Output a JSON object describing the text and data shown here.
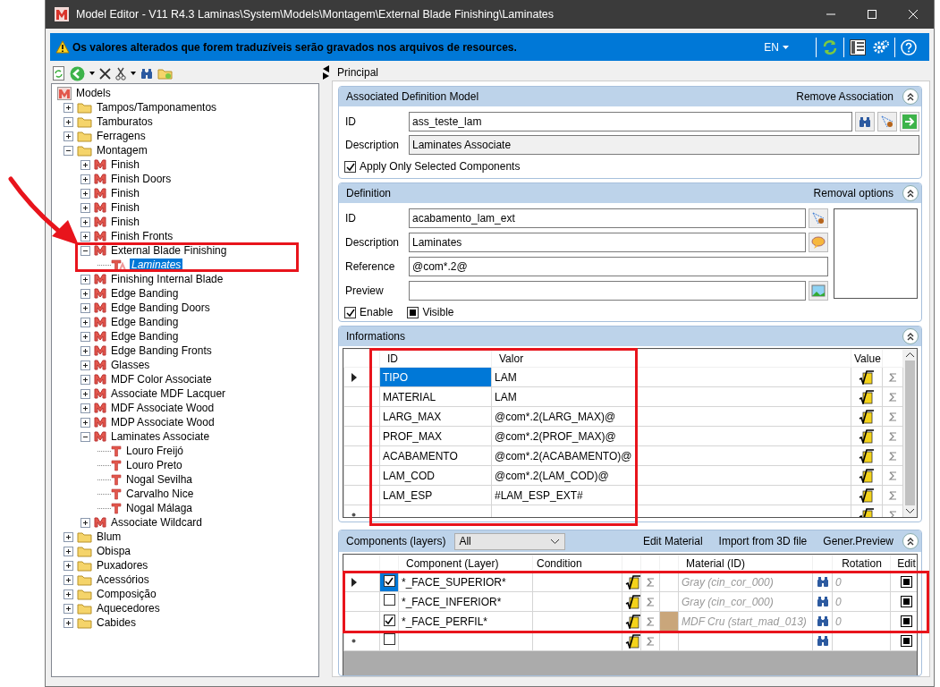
{
  "window": {
    "title": "Model Editor - V11 R4.3 Laminas\\System\\Models\\Montagem\\External Blade Finishing\\Laminates"
  },
  "info_bar": {
    "message": "Os valores alterados que forem traduzíveis serão gravados nos arquivos de resources.",
    "language": "EN"
  },
  "tree": [
    {
      "label": "Models",
      "kind": "root",
      "selected": false,
      "children": [
        {
          "label": "Tampos/Tamponamentos",
          "kind": "folder",
          "expanded": false,
          "selected": false
        },
        {
          "label": "Tamburatos",
          "kind": "folder",
          "expanded": false,
          "selected": false
        },
        {
          "label": "Ferragens",
          "kind": "folder",
          "expanded": false,
          "selected": false
        },
        {
          "label": "Montagem",
          "kind": "folder",
          "expanded": true,
          "selected": false,
          "children": [
            {
              "label": "Finish",
              "kind": "model",
              "expanded": false,
              "selected": false
            },
            {
              "label": "Finish Doors",
              "kind": "model",
              "expanded": false,
              "selected": false
            },
            {
              "label": "Finish",
              "kind": "model",
              "expanded": false,
              "selected": false
            },
            {
              "label": "Finish",
              "kind": "model",
              "expanded": false,
              "selected": false
            },
            {
              "label": "Finish",
              "kind": "model",
              "expanded": false,
              "selected": false
            },
            {
              "label": "Finish Fronts",
              "kind": "model",
              "expanded": false,
              "selected": false
            },
            {
              "label": "External Blade Finishing",
              "kind": "model",
              "expanded": true,
              "selected": false,
              "children": [
                {
                  "label": "Laminates",
                  "kind": "texture_alt",
                  "selected": true
                }
              ]
            },
            {
              "label": "Finishing Internal Blade",
              "kind": "model",
              "expanded": false,
              "selected": false
            },
            {
              "label": "Edge Banding",
              "kind": "model",
              "expanded": false,
              "selected": false
            },
            {
              "label": "Edge Banding Doors",
              "kind": "model",
              "expanded": false,
              "selected": false
            },
            {
              "label": "Edge Banding",
              "kind": "model",
              "expanded": false,
              "selected": false
            },
            {
              "label": "Edge Banding",
              "kind": "model",
              "expanded": false,
              "selected": false
            },
            {
              "label": "Edge Banding Fronts",
              "kind": "model",
              "expanded": false,
              "selected": false
            },
            {
              "label": "Glasses",
              "kind": "model",
              "expanded": false,
              "selected": false
            },
            {
              "label": "MDF Color Associate",
              "kind": "model",
              "expanded": false,
              "selected": false
            },
            {
              "label": "Associate MDF Lacquer",
              "kind": "model",
              "expanded": false,
              "selected": false
            },
            {
              "label": "MDF Associate Wood",
              "kind": "model",
              "expanded": false,
              "selected": false
            },
            {
              "label": "MDP Associate Wood",
              "kind": "model",
              "expanded": false,
              "selected": false
            },
            {
              "label": "Laminates Associate",
              "kind": "model",
              "expanded": true,
              "selected": false,
              "children": [
                {
                  "label": "Louro Freijó",
                  "kind": "texture",
                  "selected": false
                },
                {
                  "label": "Louro Preto",
                  "kind": "texture",
                  "selected": false
                },
                {
                  "label": "Nogal Sevilha",
                  "kind": "texture",
                  "selected": false
                },
                {
                  "label": "Carvalho Nice",
                  "kind": "texture",
                  "selected": false
                },
                {
                  "label": "Nogal Málaga",
                  "kind": "texture",
                  "selected": false
                }
              ]
            },
            {
              "label": "Associate Wildcard",
              "kind": "model",
              "expanded": false,
              "selected": false
            }
          ]
        },
        {
          "label": "Blum",
          "kind": "folder",
          "expanded": false,
          "selected": false
        },
        {
          "label": "Obispa",
          "kind": "folder",
          "expanded": false,
          "selected": false
        },
        {
          "label": "Puxadores",
          "kind": "folder",
          "expanded": false,
          "selected": false
        },
        {
          "label": "Acessórios",
          "kind": "folder",
          "expanded": false,
          "selected": false
        },
        {
          "label": "Composição",
          "kind": "folder",
          "expanded": false,
          "selected": false
        },
        {
          "label": "Aquecedores",
          "kind": "folder",
          "expanded": false,
          "selected": false
        },
        {
          "label": "Cabides",
          "kind": "folder",
          "expanded": false,
          "selected": false
        }
      ]
    }
  ],
  "tab": {
    "label": "Principal"
  },
  "associated": {
    "title": "Associated Definition Model",
    "link": "Remove Association",
    "fields": [
      {
        "label": "ID",
        "value": "ass_teste_lam",
        "disabled": false
      },
      {
        "label": "Description",
        "value": "Laminates Associate",
        "disabled": true
      }
    ],
    "option": {
      "label": "Apply Only Selected Components",
      "checked": true
    }
  },
  "definition": {
    "title": "Definition",
    "link": "Removal options",
    "fields": [
      {
        "label": "ID",
        "value": "acabamento_lam_ext",
        "kind": "pick"
      },
      {
        "label": "Description",
        "value": "Laminates",
        "kind": "speech"
      },
      {
        "label": "Reference",
        "value": "@com*.2@",
        "kind": "plain"
      },
      {
        "label": "Preview",
        "kind": "image"
      }
    ],
    "options": [
      {
        "label": "Enable",
        "kind": "tick",
        "checked": true
      },
      {
        "label": "Visible",
        "kind": "square",
        "checked": true
      }
    ]
  },
  "informations": {
    "title": "Informations",
    "columns": [
      "ID",
      "Valor",
      "Value"
    ],
    "rows": [
      {
        "id": "TIPO",
        "value": "LAM",
        "selected": true
      },
      {
        "id": "MATERIAL",
        "value": "LAM",
        "selected": false
      },
      {
        "id": "LARG_MAX",
        "value": "@com*.2(LARG_MAX)@",
        "selected": false
      },
      {
        "id": "PROF_MAX",
        "value": "@com*.2(PROF_MAX)@",
        "selected": false
      },
      {
        "id": "ACABAMENTO",
        "value": "@com*.2(ACABAMENTO)@",
        "selected": false
      },
      {
        "id": "LAM_COD",
        "value": "@com*.2(LAM_COD)@",
        "selected": false
      },
      {
        "id": "LAM_ESP",
        "value": "#LAM_ESP_EXT#",
        "selected": false
      }
    ]
  },
  "components": {
    "title": "Components (layers)",
    "filter": "All",
    "links": [
      "Edit Material",
      "Import from 3D file",
      "Gener.Preview"
    ],
    "columns": [
      "Component (Layer)",
      "Condition",
      "Material (ID)",
      "Rotation",
      "Edit"
    ],
    "rows": [
      {
        "checked": true,
        "layer": "*_FACE_SUPERIOR*",
        "material": "Gray (cin_cor_000)",
        "rotation": "0",
        "selected": true
      },
      {
        "checked": false,
        "layer": "*_FACE_INFERIOR*",
        "material": "Gray (cin_cor_000)",
        "rotation": "0",
        "selected": false
      },
      {
        "checked": true,
        "layer": "*_FACE_PERFIL*",
        "material": "MDF Cru (start_mad_013)",
        "color": "#c9a67b",
        "rotation": "0",
        "selected": false
      }
    ],
    "new_row": {
      "checked": false
    }
  }
}
